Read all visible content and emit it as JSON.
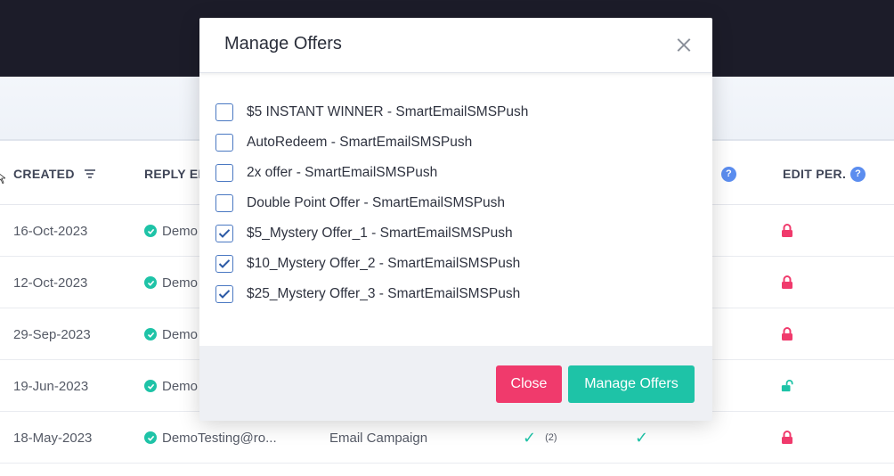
{
  "table": {
    "headers": {
      "created": "CREATED",
      "reply_email": "REPLY EM",
      "edit_per": "EDIT PER.",
      "help_glyph": "?"
    },
    "rows": [
      {
        "created": "16-Oct-2023",
        "email": "Demo",
        "type": "",
        "check1": "",
        "count": "",
        "check2": "",
        "lock": "locked"
      },
      {
        "created": "12-Oct-2023",
        "email": "Demo",
        "type": "",
        "check1": "",
        "count": "",
        "check2": "",
        "lock": "locked"
      },
      {
        "created": "29-Sep-2023",
        "email": "Demo",
        "type": "",
        "check1": "",
        "count": "",
        "check2": "",
        "lock": "locked"
      },
      {
        "created": "19-Jun-2023",
        "email": "Demo",
        "type": "",
        "check1": "",
        "count": "",
        "check2": "",
        "lock": "unlocked"
      },
      {
        "created": "18-May-2023",
        "email": "DemoTesting@ro...",
        "type": "Email Campaign",
        "check1": "✓",
        "count": "(2)",
        "check2": "✓",
        "lock": "locked"
      }
    ]
  },
  "modal": {
    "title": "Manage Offers",
    "offers": [
      {
        "label": "$5 INSTANT WINNER - SmartEmailSMSPush",
        "checked": false
      },
      {
        "label": "AutoRedeem - SmartEmailSMSPush",
        "checked": false
      },
      {
        "label": "2x offer - SmartEmailSMSPush",
        "checked": false
      },
      {
        "label": "Double Point Offer - SmartEmailSMSPush",
        "checked": false
      },
      {
        "label": "$5_Mystery Offer_1 - SmartEmailSMSPush",
        "checked": true
      },
      {
        "label": "$10_Mystery Offer_2 - SmartEmailSMSPush",
        "checked": true
      },
      {
        "label": "$25_Mystery Offer_3 - SmartEmailSMSPush",
        "checked": true
      }
    ],
    "close_label": "Close",
    "manage_label": "Manage Offers"
  },
  "colors": {
    "accent_teal": "#1ec3a7",
    "accent_pink": "#f03a6c",
    "header_dark": "#1c1c29",
    "checkbox_blue": "#4a78c2"
  }
}
